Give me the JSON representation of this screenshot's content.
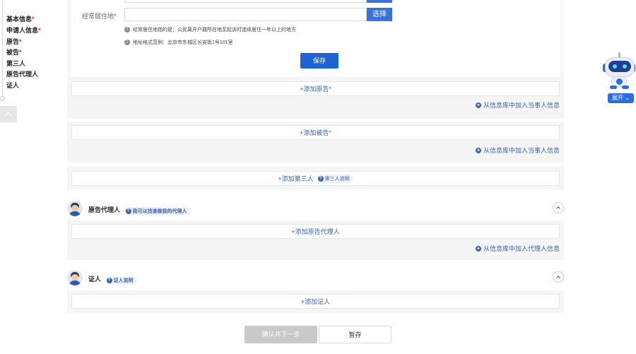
{
  "steps": [
    {
      "label": "基本信息",
      "required": "*"
    },
    {
      "label": "申请人信息",
      "required": "*"
    },
    {
      "label": "原告",
      "required": "*"
    },
    {
      "label": "被告",
      "required": "*"
    },
    {
      "label": "第三人",
      "required": ""
    },
    {
      "label": "原告代理人",
      "required": ""
    },
    {
      "label": "证人",
      "required": ""
    }
  ],
  "residence": {
    "label": "经常居住地",
    "required": "*",
    "value": "",
    "pick_button": "选择",
    "hint1": "经常居住地指的是：公民离开户籍所在地至起诉时连续居住一年以上的地方",
    "hint2": "地址格式范例：北京市东城区长安街1号101室"
  },
  "save_button": "保存",
  "plaintiff": {
    "add_label": "+添加原告",
    "required": "*",
    "library_link": "从信息库中加入当事人信息"
  },
  "defendant": {
    "add_label": "+添加被告",
    "required": "*",
    "library_link": "从信息库中加入当事人信息"
  },
  "third_party": {
    "add_label": "+添加第三人",
    "tip": "第三人说明"
  },
  "plaintiff_agent": {
    "title": "原告代理人",
    "tip": "我可以找谁做我的代理人",
    "add_label": "+添加原告代理人",
    "library_link": "从信息库中加入代理人信息"
  },
  "witness": {
    "title": "证人",
    "tip": "证人说明",
    "add_label": "+添加证人"
  },
  "footer": {
    "next_button": "确认并下一步",
    "stash_button": "暂存"
  },
  "robot": {
    "expand_label": "展开"
  },
  "colors": {
    "primary": "#1e63d6",
    "link": "#3a62b8",
    "required": "#e0303a",
    "disabled": "#c9c9c9"
  },
  "icons": {
    "hint": "info-circle-icon",
    "plus": "plus-circle-icon",
    "tip": "question-circle-icon",
    "collapse": "chevron-up-icon",
    "back_to_top": "chevron-up-icon",
    "assistant": "robot-icon"
  }
}
